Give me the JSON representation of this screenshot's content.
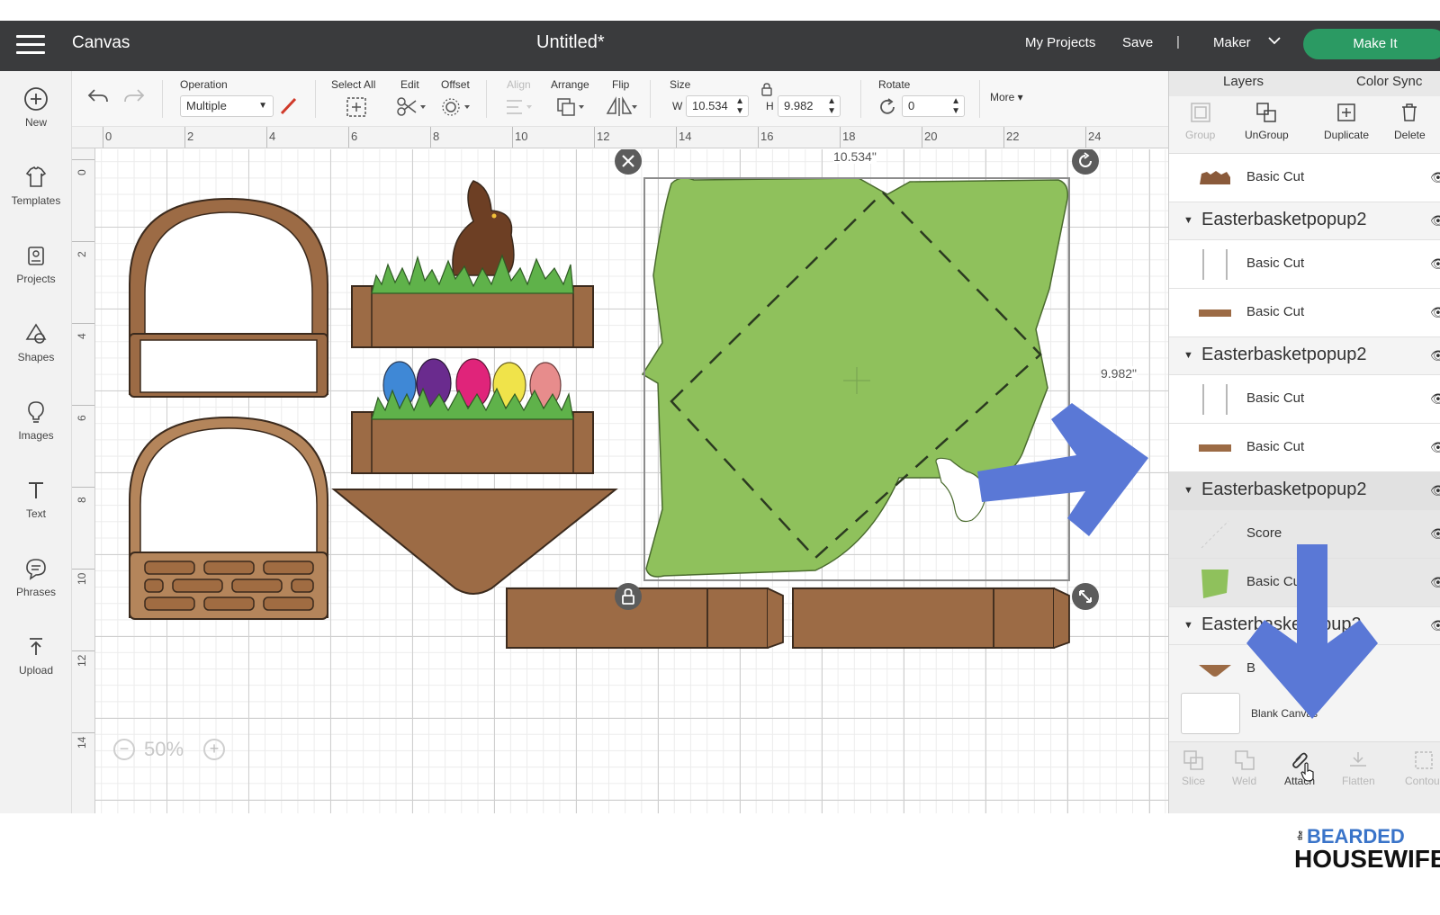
{
  "topbar": {
    "app_title": "Canvas",
    "doc_title": "Untitled*",
    "my_projects": "My Projects",
    "save": "Save",
    "divider": "|",
    "machine": "Maker",
    "make_it": "Make It"
  },
  "sidebar": {
    "items": [
      {
        "label": "New",
        "icon": "plus-circle-icon"
      },
      {
        "label": "Templates",
        "icon": "shirt-icon"
      },
      {
        "label": "Projects",
        "icon": "projects-icon"
      },
      {
        "label": "Shapes",
        "icon": "shapes-icon"
      },
      {
        "label": "Images",
        "icon": "lightbulb-icon"
      },
      {
        "label": "Text",
        "icon": "text-icon"
      },
      {
        "label": "Phrases",
        "icon": "speech-bubble-icon"
      },
      {
        "label": "Upload",
        "icon": "upload-icon"
      }
    ]
  },
  "toolbar": {
    "operation_label": "Operation",
    "operation_value": "Multiple",
    "select_all": "Select All",
    "edit": "Edit",
    "offset": "Offset",
    "align": "Align",
    "arrange": "Arrange",
    "flip": "Flip",
    "size": "Size",
    "w_label": "W",
    "w_value": "10.534",
    "h_label": "H",
    "h_value": "9.982",
    "rotate": "Rotate",
    "rotate_value": "0",
    "more": "More ▾"
  },
  "rulers": {
    "top": [
      "0",
      "2",
      "4",
      "6",
      "8",
      "10",
      "12",
      "14",
      "16",
      "18",
      "20",
      "22",
      "24"
    ],
    "left": [
      "0",
      "2",
      "4",
      "6",
      "8",
      "10",
      "12",
      "14"
    ]
  },
  "canvas": {
    "width_readout": "10.534\"",
    "height_readout": "9.982\""
  },
  "zoom": {
    "minus": "−",
    "value": "50%",
    "plus": "+"
  },
  "panel": {
    "tabs": [
      "Layers",
      "Color Sync"
    ],
    "actions": [
      "Group",
      "UnGroup",
      "Duplicate",
      "Delete"
    ],
    "layers": [
      {
        "kind": "layer",
        "name": "Basic Cut",
        "swatch": "#8a5a3a"
      },
      {
        "kind": "group",
        "name": "Easterbasketpopup2"
      },
      {
        "kind": "layer",
        "name": "Basic Cut",
        "swatch": "lines"
      },
      {
        "kind": "layer",
        "name": "Basic Cut",
        "swatch": "#9c6b45"
      },
      {
        "kind": "group",
        "name": "Easterbasketpopup2"
      },
      {
        "kind": "layer",
        "name": "Basic Cut",
        "swatch": "lines"
      },
      {
        "kind": "layer",
        "name": "Basic Cut",
        "swatch": "#9c6b45"
      },
      {
        "kind": "group",
        "name": "Easterbasketpopup2"
      },
      {
        "kind": "layer",
        "name": "Score",
        "swatch": "dashes"
      },
      {
        "kind": "layer",
        "name": "Basic Cu",
        "swatch": "#8fc15c"
      },
      {
        "kind": "group",
        "name": "Easterbaske"
      },
      {
        "kind": "layer",
        "name": "B",
        "swatch": "#9c6b45"
      }
    ],
    "group_suffix": "pup2",
    "blank_canvas": "Blank Canvas",
    "bottom": [
      "Slice",
      "Weld",
      "Attach",
      "Flatten",
      "Contour"
    ]
  },
  "logo": {
    "the": "the",
    "top": "BEARDED",
    "bottom": "HOUSEWIFE"
  },
  "colors": {
    "topbar": "#3a3b3d",
    "make_it": "#2b9a63",
    "basket_brown": "#9c6b45",
    "grass_green": "#5fb24a",
    "paper_green": "#8fc15c",
    "arrow_blue": "#5a78d6"
  }
}
